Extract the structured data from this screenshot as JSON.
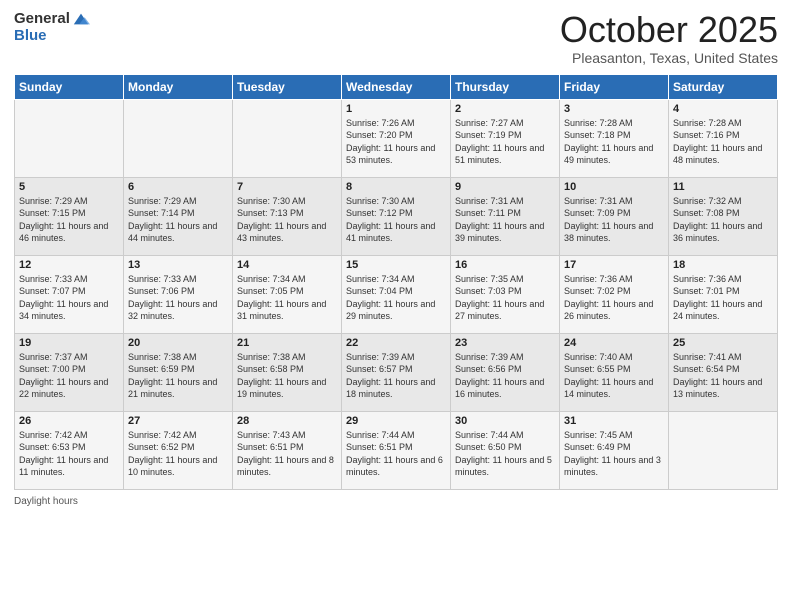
{
  "header": {
    "logo_general": "General",
    "logo_blue": "Blue",
    "month_title": "October 2025",
    "location": "Pleasanton, Texas, United States"
  },
  "days_of_week": [
    "Sunday",
    "Monday",
    "Tuesday",
    "Wednesday",
    "Thursday",
    "Friday",
    "Saturday"
  ],
  "weeks": [
    [
      {
        "day": "",
        "sunrise": "",
        "sunset": "",
        "daylight": ""
      },
      {
        "day": "",
        "sunrise": "",
        "sunset": "",
        "daylight": ""
      },
      {
        "day": "",
        "sunrise": "",
        "sunset": "",
        "daylight": ""
      },
      {
        "day": "1",
        "sunrise": "Sunrise: 7:26 AM",
        "sunset": "Sunset: 7:20 PM",
        "daylight": "Daylight: 11 hours and 53 minutes."
      },
      {
        "day": "2",
        "sunrise": "Sunrise: 7:27 AM",
        "sunset": "Sunset: 7:19 PM",
        "daylight": "Daylight: 11 hours and 51 minutes."
      },
      {
        "day": "3",
        "sunrise": "Sunrise: 7:28 AM",
        "sunset": "Sunset: 7:18 PM",
        "daylight": "Daylight: 11 hours and 49 minutes."
      },
      {
        "day": "4",
        "sunrise": "Sunrise: 7:28 AM",
        "sunset": "Sunset: 7:16 PM",
        "daylight": "Daylight: 11 hours and 48 minutes."
      }
    ],
    [
      {
        "day": "5",
        "sunrise": "Sunrise: 7:29 AM",
        "sunset": "Sunset: 7:15 PM",
        "daylight": "Daylight: 11 hours and 46 minutes."
      },
      {
        "day": "6",
        "sunrise": "Sunrise: 7:29 AM",
        "sunset": "Sunset: 7:14 PM",
        "daylight": "Daylight: 11 hours and 44 minutes."
      },
      {
        "day": "7",
        "sunrise": "Sunrise: 7:30 AM",
        "sunset": "Sunset: 7:13 PM",
        "daylight": "Daylight: 11 hours and 43 minutes."
      },
      {
        "day": "8",
        "sunrise": "Sunrise: 7:30 AM",
        "sunset": "Sunset: 7:12 PM",
        "daylight": "Daylight: 11 hours and 41 minutes."
      },
      {
        "day": "9",
        "sunrise": "Sunrise: 7:31 AM",
        "sunset": "Sunset: 7:11 PM",
        "daylight": "Daylight: 11 hours and 39 minutes."
      },
      {
        "day": "10",
        "sunrise": "Sunrise: 7:31 AM",
        "sunset": "Sunset: 7:09 PM",
        "daylight": "Daylight: 11 hours and 38 minutes."
      },
      {
        "day": "11",
        "sunrise": "Sunrise: 7:32 AM",
        "sunset": "Sunset: 7:08 PM",
        "daylight": "Daylight: 11 hours and 36 minutes."
      }
    ],
    [
      {
        "day": "12",
        "sunrise": "Sunrise: 7:33 AM",
        "sunset": "Sunset: 7:07 PM",
        "daylight": "Daylight: 11 hours and 34 minutes."
      },
      {
        "day": "13",
        "sunrise": "Sunrise: 7:33 AM",
        "sunset": "Sunset: 7:06 PM",
        "daylight": "Daylight: 11 hours and 32 minutes."
      },
      {
        "day": "14",
        "sunrise": "Sunrise: 7:34 AM",
        "sunset": "Sunset: 7:05 PM",
        "daylight": "Daylight: 11 hours and 31 minutes."
      },
      {
        "day": "15",
        "sunrise": "Sunrise: 7:34 AM",
        "sunset": "Sunset: 7:04 PM",
        "daylight": "Daylight: 11 hours and 29 minutes."
      },
      {
        "day": "16",
        "sunrise": "Sunrise: 7:35 AM",
        "sunset": "Sunset: 7:03 PM",
        "daylight": "Daylight: 11 hours and 27 minutes."
      },
      {
        "day": "17",
        "sunrise": "Sunrise: 7:36 AM",
        "sunset": "Sunset: 7:02 PM",
        "daylight": "Daylight: 11 hours and 26 minutes."
      },
      {
        "day": "18",
        "sunrise": "Sunrise: 7:36 AM",
        "sunset": "Sunset: 7:01 PM",
        "daylight": "Daylight: 11 hours and 24 minutes."
      }
    ],
    [
      {
        "day": "19",
        "sunrise": "Sunrise: 7:37 AM",
        "sunset": "Sunset: 7:00 PM",
        "daylight": "Daylight: 11 hours and 22 minutes."
      },
      {
        "day": "20",
        "sunrise": "Sunrise: 7:38 AM",
        "sunset": "Sunset: 6:59 PM",
        "daylight": "Daylight: 11 hours and 21 minutes."
      },
      {
        "day": "21",
        "sunrise": "Sunrise: 7:38 AM",
        "sunset": "Sunset: 6:58 PM",
        "daylight": "Daylight: 11 hours and 19 minutes."
      },
      {
        "day": "22",
        "sunrise": "Sunrise: 7:39 AM",
        "sunset": "Sunset: 6:57 PM",
        "daylight": "Daylight: 11 hours and 18 minutes."
      },
      {
        "day": "23",
        "sunrise": "Sunrise: 7:39 AM",
        "sunset": "Sunset: 6:56 PM",
        "daylight": "Daylight: 11 hours and 16 minutes."
      },
      {
        "day": "24",
        "sunrise": "Sunrise: 7:40 AM",
        "sunset": "Sunset: 6:55 PM",
        "daylight": "Daylight: 11 hours and 14 minutes."
      },
      {
        "day": "25",
        "sunrise": "Sunrise: 7:41 AM",
        "sunset": "Sunset: 6:54 PM",
        "daylight": "Daylight: 11 hours and 13 minutes."
      }
    ],
    [
      {
        "day": "26",
        "sunrise": "Sunrise: 7:42 AM",
        "sunset": "Sunset: 6:53 PM",
        "daylight": "Daylight: 11 hours and 11 minutes."
      },
      {
        "day": "27",
        "sunrise": "Sunrise: 7:42 AM",
        "sunset": "Sunset: 6:52 PM",
        "daylight": "Daylight: 11 hours and 10 minutes."
      },
      {
        "day": "28",
        "sunrise": "Sunrise: 7:43 AM",
        "sunset": "Sunset: 6:51 PM",
        "daylight": "Daylight: 11 hours and 8 minutes."
      },
      {
        "day": "29",
        "sunrise": "Sunrise: 7:44 AM",
        "sunset": "Sunset: 6:51 PM",
        "daylight": "Daylight: 11 hours and 6 minutes."
      },
      {
        "day": "30",
        "sunrise": "Sunrise: 7:44 AM",
        "sunset": "Sunset: 6:50 PM",
        "daylight": "Daylight: 11 hours and 5 minutes."
      },
      {
        "day": "31",
        "sunrise": "Sunrise: 7:45 AM",
        "sunset": "Sunset: 6:49 PM",
        "daylight": "Daylight: 11 hours and 3 minutes."
      },
      {
        "day": "",
        "sunrise": "",
        "sunset": "",
        "daylight": ""
      }
    ]
  ],
  "footer": {
    "daylight_label": "Daylight hours"
  }
}
